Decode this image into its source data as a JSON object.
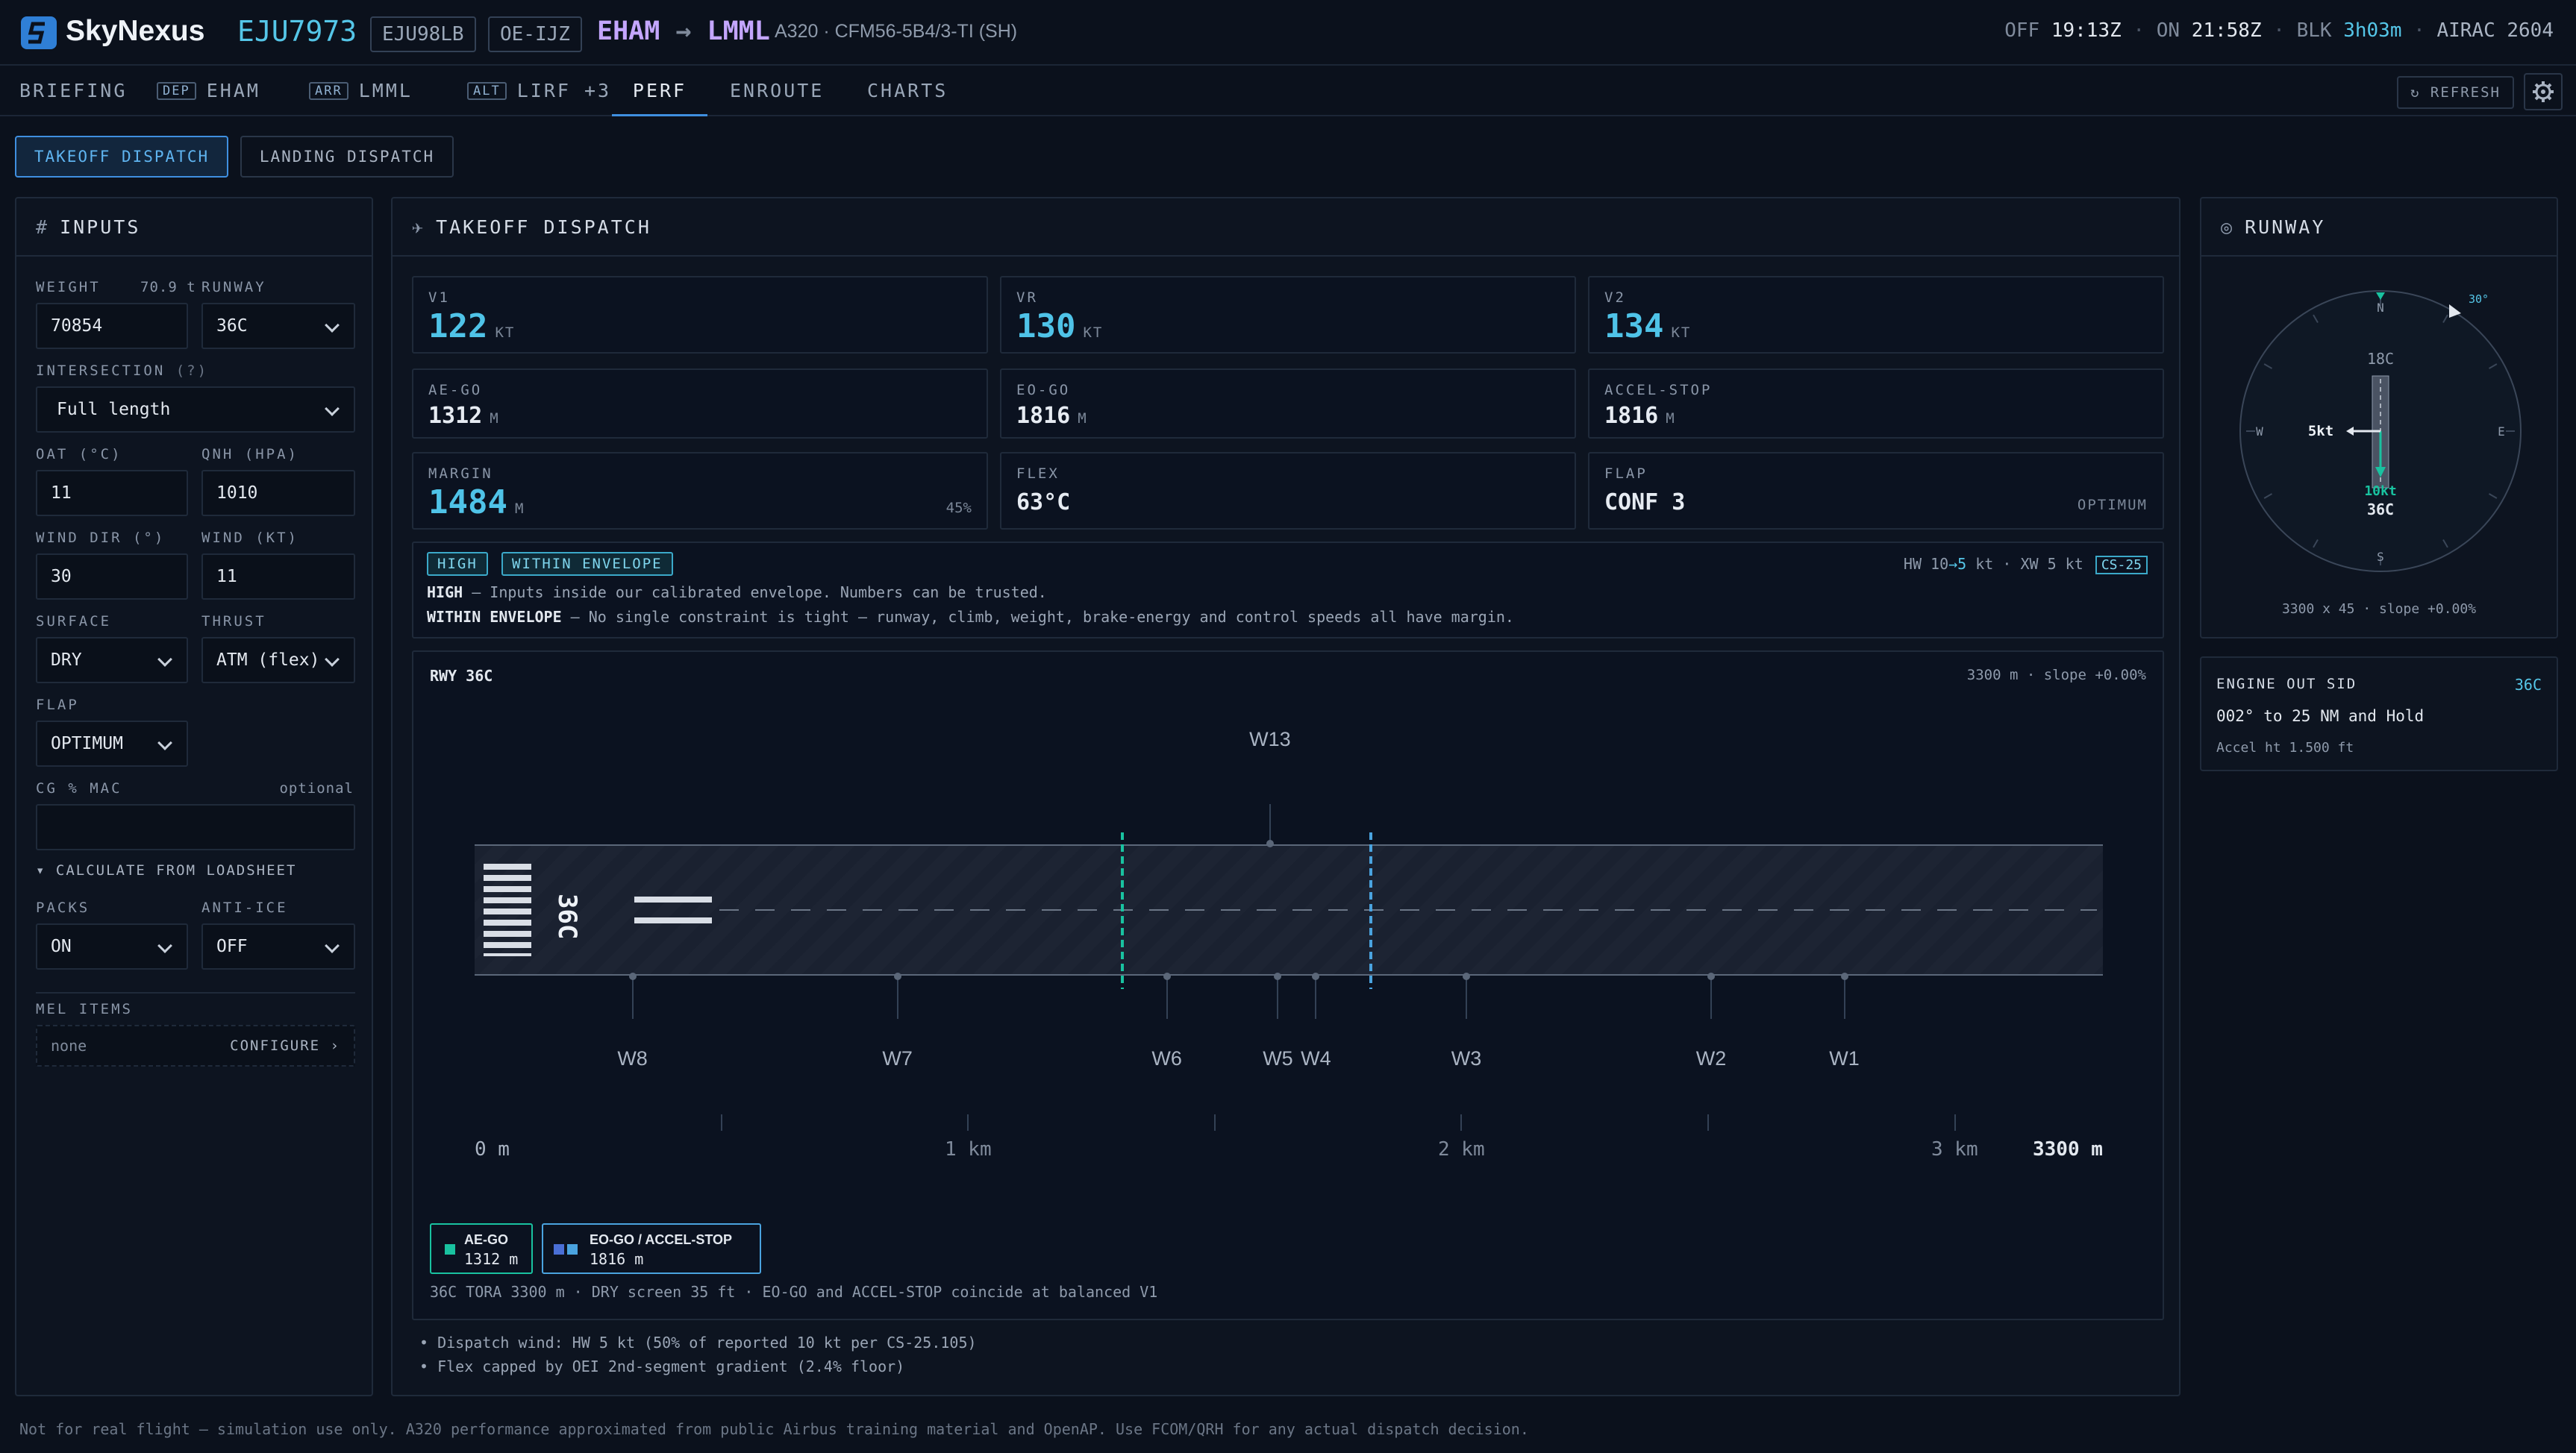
{
  "header": {
    "brand": "SkyNexus",
    "flight": "EJU7973",
    "callsign": "EJU98LB",
    "registration": "OE-IJZ",
    "origin": "EHAM",
    "arrow": "→",
    "destination": "LMML",
    "aircraft": "A320 · CFM56-5B4/3-TI (SH)",
    "off_label": "OFF",
    "off_time": "19:13Z",
    "on_label": "ON",
    "on_time": "21:58Z",
    "blk_label": "BLK",
    "blk_time": "3h03m",
    "airac": "AIRAC 2604"
  },
  "tabs": {
    "briefing": "BRIEFING",
    "dep_tag": "DEP",
    "dep": "EHAM",
    "arr_tag": "ARR",
    "arr": "LMML",
    "alt_tag": "ALT",
    "alt": "LIRF +3",
    "perf": "PERF",
    "enroute": "ENROUTE",
    "charts": "CHARTS",
    "refresh": "↻ REFRESH"
  },
  "subtabs": {
    "takeoff": "TAKEOFF DISPATCH",
    "landing": "LANDING DISPATCH"
  },
  "inputs": {
    "title": "INPUTS",
    "weight_label": "WEIGHT",
    "weight_hint": "70.9 t",
    "weight": "70854",
    "runway_label": "RUNWAY",
    "runway": "36C",
    "intersection_label": "INTERSECTION",
    "intersection_hint": "(?)",
    "intersection": "Full length",
    "oat_label": "OAT (°C)",
    "oat": "11",
    "qnh_label": "QNH (HPA)",
    "qnh": "1010",
    "wind_dir_label": "WIND DIR (°)",
    "wind_dir": "30",
    "wind_kt_label": "WIND (KT)",
    "wind_kt": "11",
    "surface_label": "SURFACE",
    "surface": "DRY",
    "thrust_label": "THRUST",
    "thrust": "ATM (flex)",
    "flap_label": "FLAP",
    "flap": "OPTIMUM",
    "cg_label": "CG % MAC",
    "cg_hint": "optional",
    "cg": "",
    "loadsheet": "▾ CALCULATE FROM LOADSHEET",
    "packs_label": "PACKS",
    "packs": "ON",
    "antiice_label": "ANTI-ICE",
    "antiice": "OFF",
    "mel_label": "MEL ITEMS",
    "mel": "none",
    "mel_configure": "CONFIGURE ›"
  },
  "dispatch": {
    "title": "TAKEOFF DISPATCH",
    "v1_label": "V1",
    "v1": "122",
    "v1_unit": "KT",
    "vr_label": "VR",
    "vr": "130",
    "vr_unit": "KT",
    "v2_label": "V2",
    "v2": "134",
    "v2_unit": "KT",
    "aego_label": "AE-GO",
    "aego": "1312",
    "aego_unit": "M",
    "eogo_label": "EO-GO",
    "eogo": "1816",
    "eogo_unit": "M",
    "accel_label": "ACCEL-STOP",
    "accel": "1816",
    "accel_unit": "M",
    "margin_label": "MARGIN",
    "margin": "1484",
    "margin_unit": "M",
    "margin_pct": "45%",
    "flex_label": "FLEX",
    "flex": "63°C",
    "flap_label": "FLAP",
    "flap": "CONF 3",
    "flap_note": "OPTIMUM",
    "badge_high": "HIGH",
    "badge_env": "WITHIN ENVELOPE",
    "wind_hw": "HW 10",
    "wind_arrow": "→5",
    "wind_rest": "kt · XW 5 kt",
    "cert": "CS-25",
    "note1_key": "HIGH",
    "note1": " — Inputs inside our calibrated envelope. Numbers can be trusted.",
    "note2_key": "WITHIN ENVELOPE",
    "note2": " — No single constraint is tight — runway, climb, weight, brake-energy and control speeds all have margin."
  },
  "runway_diagram": {
    "rwy_label": "RWY 36C",
    "rwy_info": "3300 m · slope +0.00%",
    "designator": "36C",
    "length_m": 3300,
    "aego_m": 1312,
    "eogo_m": 1816,
    "taxiways_top": [
      {
        "name": "W13",
        "m": 1612
      }
    ],
    "taxiways_bottom": [
      {
        "name": "W8",
        "m": 320
      },
      {
        "name": "W7",
        "m": 857
      },
      {
        "name": "W6",
        "m": 1403
      },
      {
        "name": "W5",
        "m": 1628
      },
      {
        "name": "W4",
        "m": 1705
      },
      {
        "name": "W3",
        "m": 2010
      },
      {
        "name": "W2",
        "m": 2506
      },
      {
        "name": "W1",
        "m": 2776
      }
    ],
    "dist_0": "0 m",
    "dist_1": "1 km",
    "dist_2": "2 km",
    "dist_3": "3 km",
    "dist_end": "3300 m",
    "legend_aego_label": "AE-GO",
    "legend_aego": "1312 m",
    "legend_eogo_label": "EO-GO / ACCEL-STOP",
    "legend_eogo": "1816 m",
    "footnote": "36C TORA 3300 m · DRY screen 35 ft · EO-GO and ACCEL-STOP coincide at balanced V1",
    "colors": {
      "aego": "#19c2a0",
      "eogo": "#4aa3df"
    }
  },
  "bullets": [
    "• Dispatch wind: HW 5 kt (50% of reported 10 kt per CS-25.105)",
    "• Flex capped by OEI 2nd-segment gradient (2.4% floor)"
  ],
  "runway_panel": {
    "title": "RUNWAY",
    "n": "N",
    "e": "E",
    "s": "S",
    "w": "W",
    "wind_dir": "30°",
    "rwy_top": "18C",
    "rwy_bottom": "36C",
    "xwind": "5kt",
    "hwind": "10kt",
    "dims": "3300 x 45 · slope +0.00%"
  },
  "sid": {
    "title": "ENGINE OUT SID",
    "rwy": "36C",
    "route": "002° to 25 NM and Hold",
    "accel": "Accel ht 1.500 ft"
  },
  "footer": "Not for real flight — simulation use only. A320 performance approximated from public Airbus training material and OpenAP. Use FCOM/QRH for any actual dispatch decision."
}
